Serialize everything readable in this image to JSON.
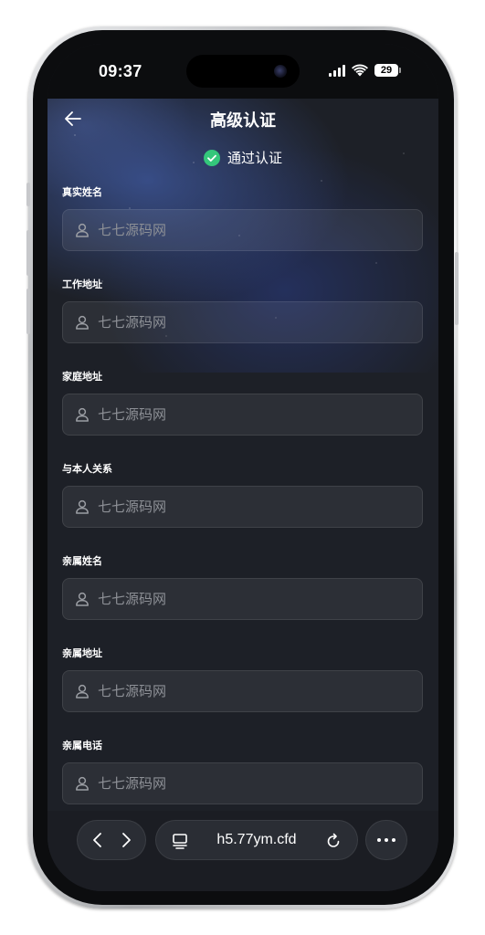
{
  "status_bar": {
    "time": "09:37",
    "battery": "29"
  },
  "header": {
    "title": "高级认证"
  },
  "verification": {
    "text": "通过认证",
    "color": "#34c77b"
  },
  "fields": [
    {
      "label": "真实姓名",
      "placeholder": "七七源码网"
    },
    {
      "label": "工作地址",
      "placeholder": "七七源码网"
    },
    {
      "label": "家庭地址",
      "placeholder": "七七源码网"
    },
    {
      "label": "与本人关系",
      "placeholder": "七七源码网"
    },
    {
      "label": "亲属姓名",
      "placeholder": "七七源码网"
    },
    {
      "label": "亲属地址",
      "placeholder": "七七源码网"
    },
    {
      "label": "亲属电话",
      "placeholder": "七七源码网"
    }
  ],
  "browser_bar": {
    "url": "h5.77ym.cfd"
  },
  "icons": {
    "back": "arrow-left-icon",
    "verified": "check-circle-icon",
    "field": "user-icon",
    "nav_back": "chevron-left-icon",
    "nav_forward": "chevron-right-icon",
    "tabs": "tabs-icon",
    "reload": "reload-icon",
    "more": "more-icon"
  }
}
